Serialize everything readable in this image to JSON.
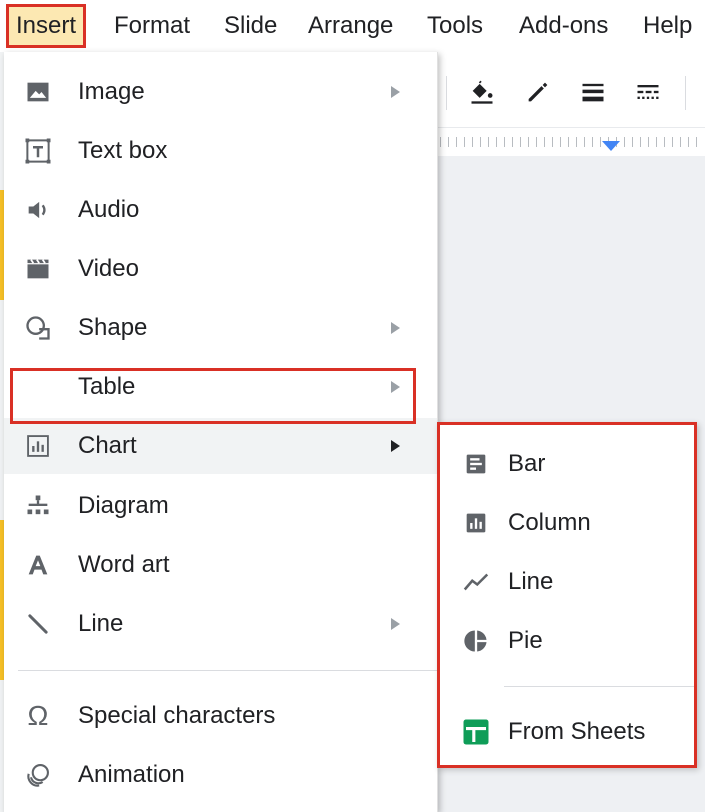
{
  "menubar": {
    "items": [
      {
        "label": "Insert",
        "active": true
      },
      {
        "label": "Format"
      },
      {
        "label": "Slide"
      },
      {
        "label": "Arrange"
      },
      {
        "label": "Tools"
      },
      {
        "label": "Add-ons"
      },
      {
        "label": "Help"
      }
    ]
  },
  "toolbar": {
    "icons": [
      "paint-bucket-icon",
      "pencil-icon",
      "line-weight-icon",
      "line-dash-icon"
    ]
  },
  "insert_menu": {
    "items": [
      {
        "label": "Image",
        "icon": "image-icon",
        "has_submenu": true
      },
      {
        "label": "Text box",
        "icon": "text-box-icon",
        "has_submenu": false
      },
      {
        "label": "Audio",
        "icon": "audio-icon",
        "has_submenu": false
      },
      {
        "label": "Video",
        "icon": "video-icon",
        "has_submenu": false
      },
      {
        "label": "Shape",
        "icon": "shape-icon",
        "has_submenu": true
      },
      {
        "label": "Table",
        "icon": "",
        "has_submenu": true
      },
      {
        "label": "Chart",
        "icon": "chart-icon",
        "has_submenu": true,
        "highlighted": true
      },
      {
        "label": "Diagram",
        "icon": "diagram-icon",
        "has_submenu": false
      },
      {
        "label": "Word art",
        "icon": "word-art-icon",
        "has_submenu": false
      },
      {
        "label": "Line",
        "icon": "line-icon",
        "has_submenu": true
      },
      {
        "label": "Special characters",
        "icon": "omega-icon",
        "has_submenu": false
      },
      {
        "label": "Animation",
        "icon": "animation-icon",
        "has_submenu": false
      }
    ]
  },
  "chart_submenu": {
    "items": [
      {
        "label": "Bar",
        "icon": "bar-chart-icon"
      },
      {
        "label": "Column",
        "icon": "column-chart-icon"
      },
      {
        "label": "Line",
        "icon": "line-chart-icon"
      },
      {
        "label": "Pie",
        "icon": "pie-chart-icon"
      },
      {
        "label": "From Sheets",
        "icon": "sheets-icon"
      }
    ]
  },
  "colors": {
    "highlight_border": "#d93025",
    "insert_bg": "#fce8b2",
    "ruler_marker": "#4285f4",
    "sheets_green": "#0f9d58",
    "icon_gray": "#5f6368"
  }
}
